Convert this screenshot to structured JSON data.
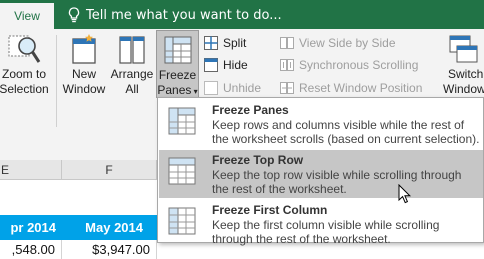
{
  "tabbar": {
    "view_tab": "View",
    "tell_me": "Tell me what you want to do..."
  },
  "ribbon": {
    "zoom_to_selection": [
      "Zoom to",
      "Selection"
    ],
    "new_window": [
      "New",
      "Window"
    ],
    "arrange_all": [
      "Arrange",
      "All"
    ],
    "freeze_panes": [
      "Freeze",
      "Panes"
    ],
    "split": "Split",
    "hide": "Hide",
    "unhide": "Unhide",
    "view_side_by_side": "View Side by Side",
    "synchronous_scrolling": "Synchronous Scrolling",
    "reset_window_position": "Reset Window Position",
    "switch_windows": [
      "Switch",
      "Windows"
    ]
  },
  "sheet": {
    "col_e": "E",
    "col_f": "F",
    "header_cells": [
      "pr 2014",
      "May 2014"
    ],
    "value_cells": [
      ",548.00",
      "$3,947.00"
    ]
  },
  "menu": {
    "items": [
      {
        "title": "Freeze Panes",
        "desc": "Keep rows and columns visible while the rest of the worksheet scrolls (based on current selection)."
      },
      {
        "title": "Freeze Top Row",
        "desc": "Keep the top row visible while scrolling through the rest of the worksheet."
      },
      {
        "title": "Freeze First Column",
        "desc": "Keep the first column visible while scrolling through the rest of the worksheet."
      }
    ],
    "selected_index": 1
  },
  "colors": {
    "accent_green": "#217346",
    "header_blue": "#00a2e8",
    "menu_highlight": "#c6c6c6"
  },
  "icons": [
    "lightbulb-icon",
    "zoom-to-selection-icon",
    "new-window-icon",
    "arrange-all-icon",
    "freeze-panes-icon",
    "split-icon",
    "hide-icon",
    "unhide-icon",
    "view-side-by-side-icon",
    "synchronous-scrolling-icon",
    "reset-window-position-icon",
    "switch-windows-icon",
    "mouse-pointer-icon"
  ]
}
